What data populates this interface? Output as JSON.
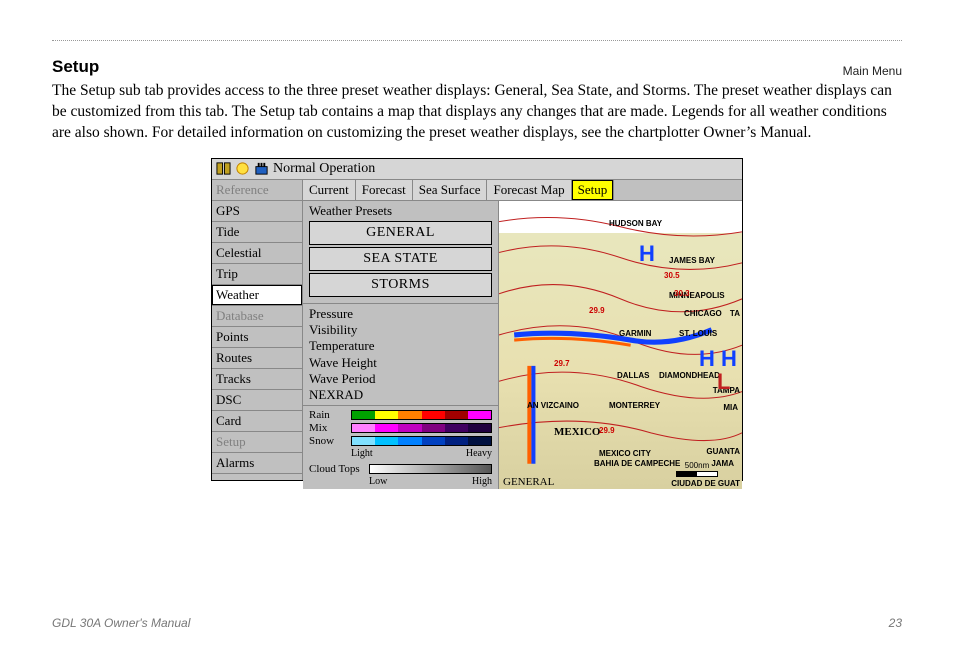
{
  "header": {
    "right": "Main Menu"
  },
  "section": {
    "title": "Setup",
    "body": "The Setup sub tab provides access to the three preset weather displays: General, Sea State, and Storms. The preset weather displays can be customized from this tab. The Setup tab contains a map that displays any changes that are made. Legends for all weather conditions are also shown. For detailed information on customizing the preset weather displays, see the chartplotter Owner’s Manual."
  },
  "footer": {
    "left": "GDL 30A Owner's Manual",
    "right": "23"
  },
  "device": {
    "title": "Normal Operation",
    "sidebar": [
      {
        "label": "Reference",
        "state": "disabled"
      },
      {
        "label": "GPS",
        "state": "normal"
      },
      {
        "label": "Tide",
        "state": "normal"
      },
      {
        "label": "Celestial",
        "state": "normal"
      },
      {
        "label": "Trip",
        "state": "normal"
      },
      {
        "label": "Weather",
        "state": "selected"
      },
      {
        "label": "Database",
        "state": "disabled"
      },
      {
        "label": "Points",
        "state": "normal"
      },
      {
        "label": "Routes",
        "state": "normal"
      },
      {
        "label": "Tracks",
        "state": "normal"
      },
      {
        "label": "DSC",
        "state": "normal"
      },
      {
        "label": "Card",
        "state": "normal"
      },
      {
        "label": "Setup",
        "state": "disabled"
      },
      {
        "label": "Alarms",
        "state": "normal"
      }
    ],
    "tabs": [
      {
        "label": "Current",
        "active": false
      },
      {
        "label": "Forecast",
        "active": false
      },
      {
        "label": "Sea Surface",
        "active": false
      },
      {
        "label": "Forecast Map",
        "active": false
      },
      {
        "label": "Setup",
        "active": true
      }
    ],
    "presets_label": "Weather Presets",
    "preset_buttons": [
      "GENERAL",
      "SEA STATE",
      "STORMS"
    ],
    "params": [
      "Pressure",
      "Visibility",
      "Temperature",
      "Wave Height",
      "Wave Period",
      "NEXRAD"
    ],
    "precip_legend": {
      "rows": [
        "Rain",
        "Mix",
        "Snow"
      ],
      "rain_colors": [
        "#00a000",
        "#ffff00",
        "#ff8000",
        "#ff0000",
        "#a00000",
        "#ff00ff"
      ],
      "mix_colors": [
        "#ff80ff",
        "#ff00ff",
        "#c000c0",
        "#800080",
        "#400060",
        "#200040"
      ],
      "snow_colors": [
        "#80e0ff",
        "#00c0ff",
        "#0080ff",
        "#0040c0",
        "#002080",
        "#001040"
      ],
      "scale_low": "Light",
      "scale_high": "Heavy"
    },
    "cloud_legend": {
      "label": "Cloud Tops",
      "scale_low": "Low",
      "scale_high": "High"
    },
    "map": {
      "places": {
        "hudson": "HUDSON BAY",
        "james": "JAMES BAY",
        "mpls": "MINNEAPOLIS",
        "chicago": "CHICAGO",
        "garmin": "GARMIN",
        "stlouis": "ST. LOUIS",
        "dallas": "DALLAS",
        "diamond": "DIAMONDHEAD",
        "tampa": "TAMPA",
        "mia": "MIA",
        "vizcaino": "AN VIZCAINO",
        "monterrey": "MONTERREY",
        "mexico": "MEXICO",
        "mexcity": "MEXICO CITY",
        "bahia": "BAHIA DE CAMPECHE",
        "guanta": "GUANTA",
        "jama": "JAMA",
        "guat": "CIUDAD DE GUAT",
        "ta": "TA"
      },
      "pressures": {
        "p305": "30.5",
        "p303": "30.3",
        "p299": "29.9",
        "p297": "29.7",
        "p299b": "29.9"
      },
      "footer": "GENERAL",
      "scale": "500nm"
    }
  }
}
